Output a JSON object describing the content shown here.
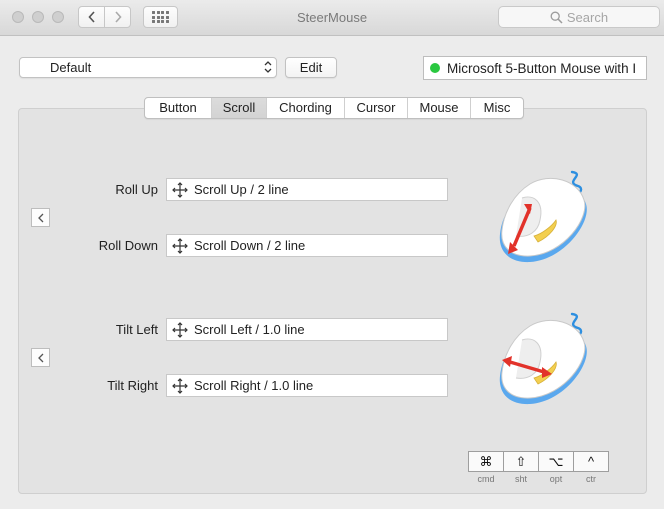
{
  "window": {
    "title": "SteerMouse"
  },
  "search": {
    "placeholder": "Search",
    "icon": "magnifier-icon"
  },
  "profile": {
    "value": "Default",
    "edit_label": "Edit"
  },
  "device": {
    "name": "Microsoft 5-Button Mouse with I",
    "status_color": "#2ac840"
  },
  "tabs": [
    {
      "label": "Button",
      "active": false
    },
    {
      "label": "Scroll",
      "active": true
    },
    {
      "label": "Chording",
      "active": false
    },
    {
      "label": "Cursor",
      "active": false
    },
    {
      "label": "Mouse",
      "active": false
    },
    {
      "label": "Misc",
      "active": false
    }
  ],
  "wheel": {
    "roll_up": {
      "label": "Roll Up",
      "action": "Scroll Up / 2 line"
    },
    "roll_down": {
      "label": "Roll Down",
      "action": "Scroll Down / 2 line"
    },
    "tilt_left": {
      "label": "Tilt Left",
      "action": "Scroll Left / 1.0 line"
    },
    "tilt_right": {
      "label": "Tilt Right",
      "action": "Scroll Right / 1.0 line"
    }
  },
  "modifiers": [
    {
      "symbol": "⌘",
      "label": "cmd"
    },
    {
      "symbol": "⇧",
      "label": "sht"
    },
    {
      "symbol": "⌥",
      "label": "opt"
    },
    {
      "symbol": "^",
      "label": "ctr"
    }
  ],
  "colors": {
    "arrow": "#e2322a",
    "cable": "#2d8fe0",
    "accent_button": "#f3cf4f"
  }
}
